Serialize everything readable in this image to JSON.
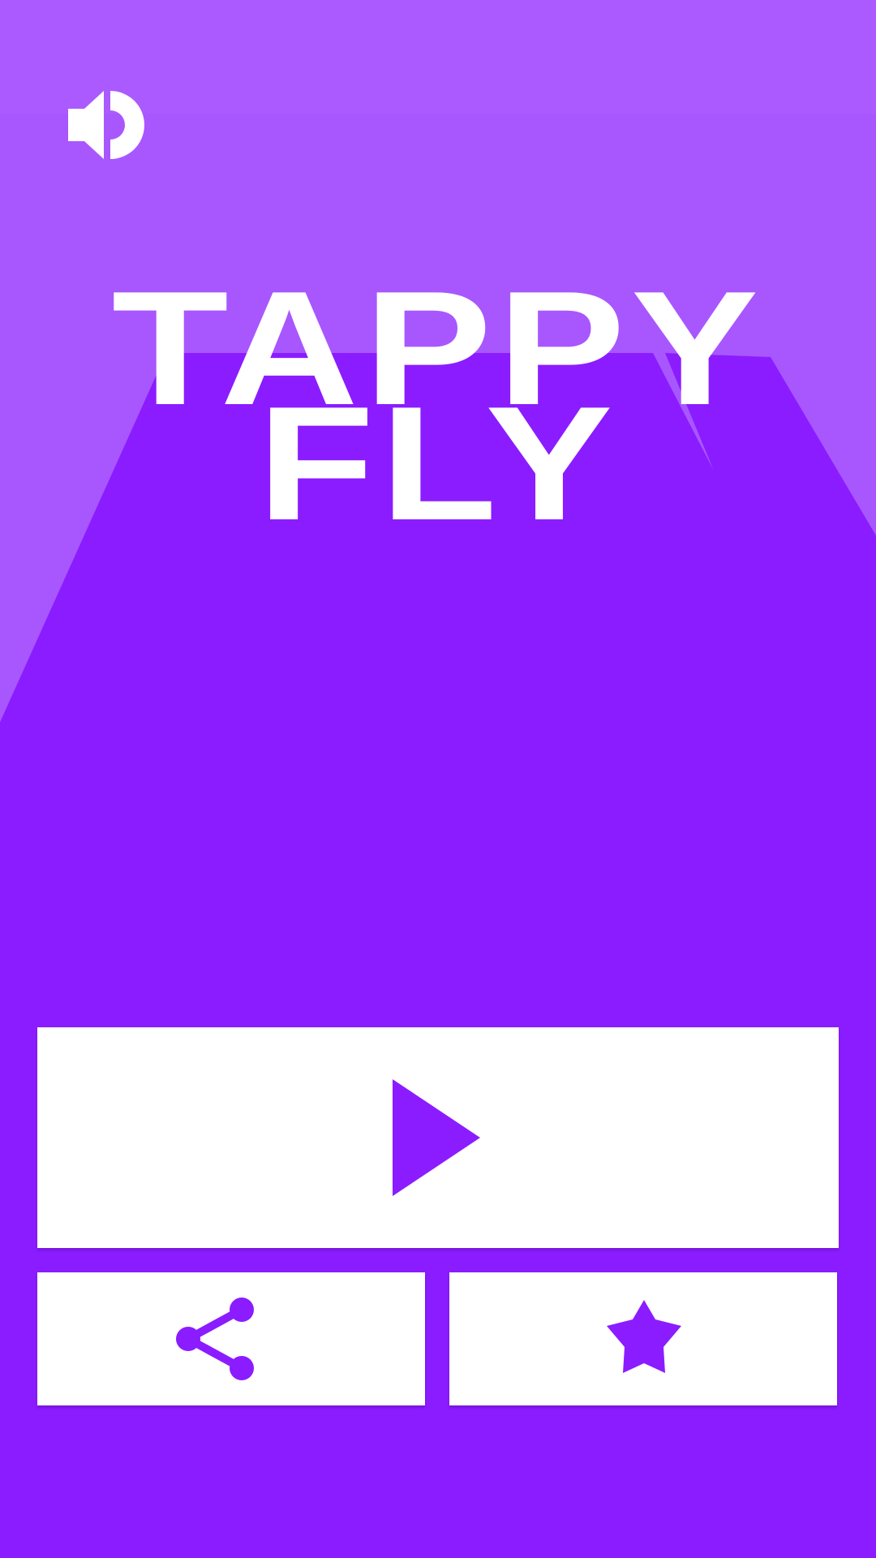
{
  "title": {
    "line1": "TAPPY",
    "line2": "FLY"
  },
  "colors": {
    "background": "#8b1cff",
    "background_light": "#a857ff",
    "button": "#ffffff",
    "icon": "#8b1cff",
    "title_text": "#ffffff"
  },
  "icons": {
    "sound": "speaker-icon",
    "play": "play-icon",
    "share": "share-icon",
    "rate": "star-icon"
  }
}
